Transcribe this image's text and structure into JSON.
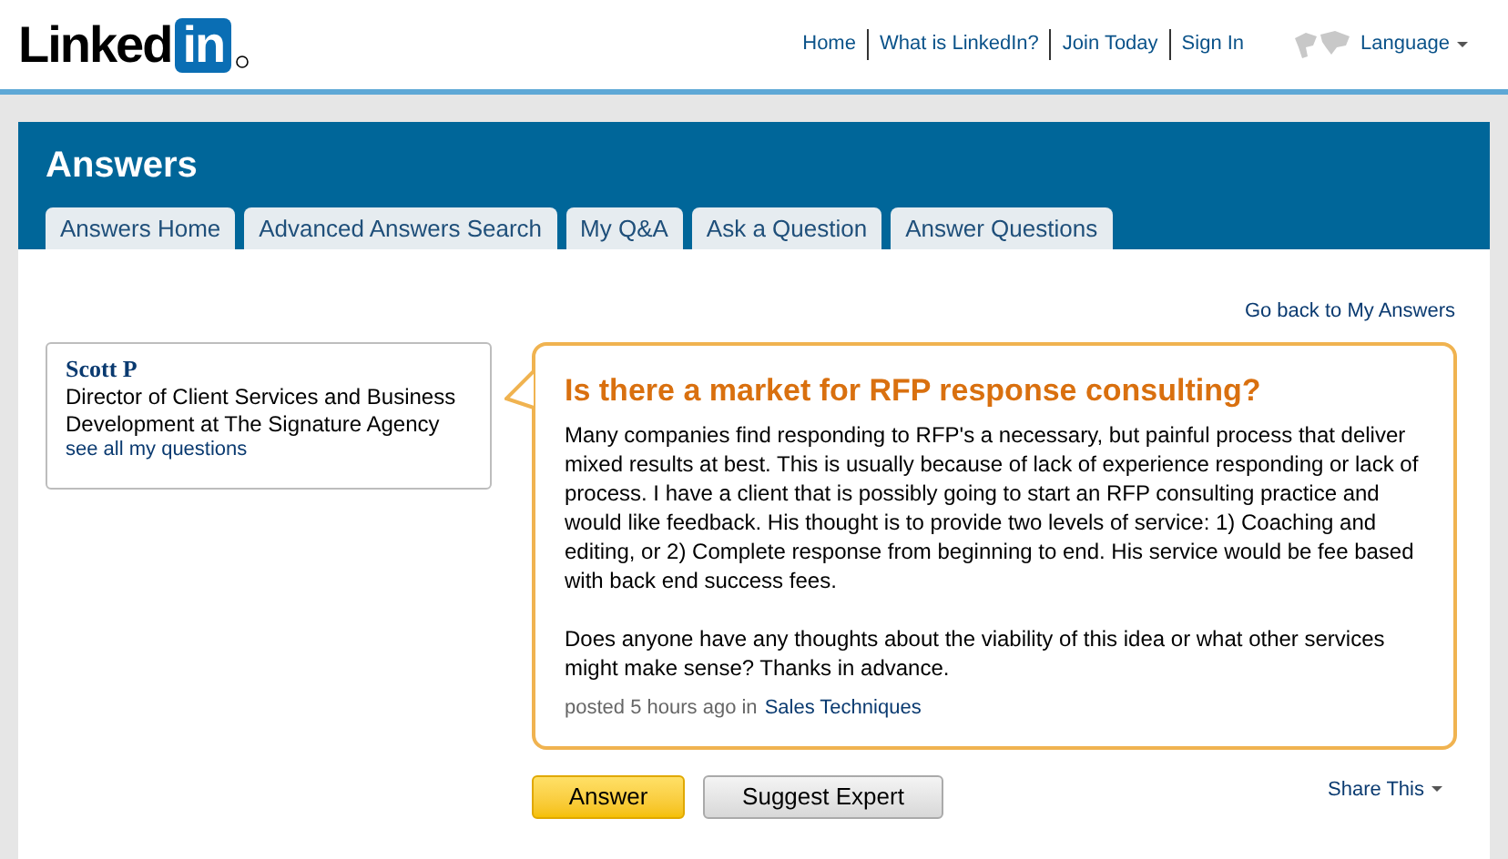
{
  "header": {
    "logo": {
      "text": "Linked",
      "badge": "in"
    },
    "nav": [
      "Home",
      "What is LinkedIn?",
      "Join Today",
      "Sign In"
    ],
    "language": "Language"
  },
  "section": {
    "title": "Answers",
    "tabs": [
      "Answers Home",
      "Advanced Answers Search",
      "My Q&A",
      "Ask a Question",
      "Answer Questions"
    ]
  },
  "back_link": "Go back to My Answers",
  "author": {
    "name": "Scott P",
    "headline": "Director of Client Services and Business Development at The Signature Agency",
    "link": "see all my questions"
  },
  "question": {
    "title": "Is there a market for RFP response consulting?",
    "paragraphs": [
      "Many companies find responding to RFP's a necessary, but painful process that deliver mixed results at best. This is usually because of lack of experience responding or lack of process. I have a client that is possibly going to start an RFP consulting practice and would like feedback. His thought is to provide two levels of service: 1) Coaching and editing, or 2) Complete response from beginning to end. His service would be fee based with back end success fees.",
      "Does anyone have any thoughts about the viability of this idea or what other services might make sense? Thanks in advance."
    ],
    "posted": "posted 5 hours ago in",
    "category": "Sales Techniques"
  },
  "buttons": [
    {
      "label": "Answer",
      "kind": "primary"
    },
    {
      "label": "Suggest Expert",
      "kind": "secondary"
    }
  ],
  "share": "Share This"
}
